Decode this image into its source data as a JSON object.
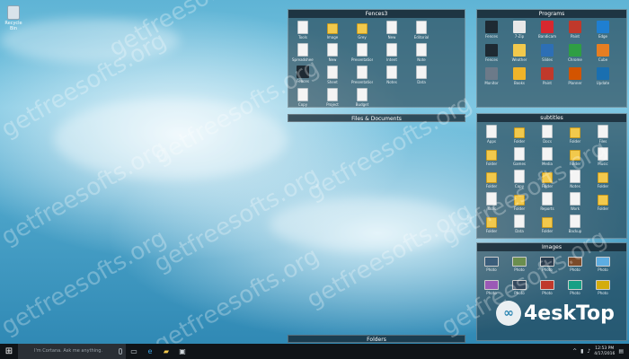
{
  "desktop": {
    "recycle_bin_label": "Recycle Bin"
  },
  "fences": {
    "fences3": {
      "title": "Fences3",
      "items": [
        {
          "label": "Tools",
          "kind": "doc"
        },
        {
          "label": "Image",
          "kind": "folder"
        },
        {
          "label": "Grey",
          "kind": "folder"
        },
        {
          "label": "New",
          "kind": "doc"
        },
        {
          "label": "Editorial",
          "kind": "doc"
        },
        {
          "label": "Spreadsheet",
          "kind": "doc"
        },
        {
          "label": "New",
          "kind": "doc"
        },
        {
          "label": "Presentation",
          "kind": "doc"
        },
        {
          "label": "Intent",
          "kind": "doc"
        },
        {
          "label": "Note",
          "kind": "doc"
        },
        {
          "label": "Fences",
          "kind": "app",
          "color": "#1e2a33"
        },
        {
          "label": "Sheet",
          "kind": "doc"
        },
        {
          "label": "Presentation",
          "kind": "doc"
        },
        {
          "label": "Notes",
          "kind": "doc"
        },
        {
          "label": "Data",
          "kind": "doc"
        },
        {
          "label": "Copy",
          "kind": "doc"
        },
        {
          "label": "Project",
          "kind": "doc"
        },
        {
          "label": "Budget",
          "kind": "doc"
        }
      ]
    },
    "programs": {
      "title": "Programs",
      "items": [
        {
          "label": "Fences",
          "kind": "app",
          "color": "#1e2a33"
        },
        {
          "label": "7-Zip",
          "kind": "app",
          "color": "#e8e8e8"
        },
        {
          "label": "Bandicam",
          "kind": "app",
          "color": "#d7282f"
        },
        {
          "label": "Paint",
          "kind": "app",
          "color": "#c0392b"
        },
        {
          "label": "Edge",
          "kind": "app",
          "color": "#1f7fd1"
        },
        {
          "label": "Fences",
          "kind": "app",
          "color": "#1e2a33"
        },
        {
          "label": "Weather",
          "kind": "app",
          "color": "#f2c94c"
        },
        {
          "label": "Slides",
          "kind": "app",
          "color": "#2d6fb5"
        },
        {
          "label": "Chrome",
          "kind": "app",
          "color": "#2f9e44"
        },
        {
          "label": "Cube",
          "kind": "app",
          "color": "#e67e22"
        },
        {
          "label": "Monitor",
          "kind": "app",
          "color": "#6c7a89"
        },
        {
          "label": "Books",
          "kind": "app",
          "color": "#f0b429"
        },
        {
          "label": "Paint",
          "kind": "app",
          "color": "#c0392b"
        },
        {
          "label": "Planner",
          "kind": "app",
          "color": "#d35400"
        },
        {
          "label": "Update",
          "kind": "app",
          "color": "#1a6fb0"
        }
      ]
    },
    "files_documents": {
      "title": "Files & Documents"
    },
    "subtitles": {
      "title": "subtitles",
      "items": [
        {
          "label": "Apps",
          "kind": "doc"
        },
        {
          "label": "Folder",
          "kind": "folder"
        },
        {
          "label": "Docs",
          "kind": "doc"
        },
        {
          "label": "Folder",
          "kind": "folder"
        },
        {
          "label": "Files",
          "kind": "doc"
        },
        {
          "label": "Folder",
          "kind": "folder"
        },
        {
          "label": "Games",
          "kind": "doc"
        },
        {
          "label": "Media",
          "kind": "doc"
        },
        {
          "label": "Folder",
          "kind": "folder"
        },
        {
          "label": "Music",
          "kind": "doc"
        },
        {
          "label": "Folder",
          "kind": "folder"
        },
        {
          "label": "Copy",
          "kind": "doc"
        },
        {
          "label": "Folder",
          "kind": "folder"
        },
        {
          "label": "Notes",
          "kind": "doc"
        },
        {
          "label": "Folder",
          "kind": "folder"
        },
        {
          "label": "Tools",
          "kind": "doc"
        },
        {
          "label": "Folder",
          "kind": "folder"
        },
        {
          "label": "Reports",
          "kind": "doc"
        },
        {
          "label": "Work",
          "kind": "doc"
        },
        {
          "label": "Folder",
          "kind": "folder"
        },
        {
          "label": "Folder",
          "kind": "folder"
        },
        {
          "label": "Data",
          "kind": "doc"
        },
        {
          "label": "Folder",
          "kind": "folder"
        },
        {
          "label": "Backup",
          "kind": "doc"
        }
      ]
    },
    "images": {
      "title": "Images",
      "items": [
        {
          "label": "Photo",
          "kind": "img",
          "color": "#3a5d7a"
        },
        {
          "label": "Photo",
          "kind": "img",
          "color": "#6b8e4e"
        },
        {
          "label": "Photo",
          "kind": "img",
          "color": "#2c3e50"
        },
        {
          "label": "Photo",
          "kind": "img",
          "color": "#7b4b2a"
        },
        {
          "label": "Photo",
          "kind": "img",
          "color": "#5dade2"
        },
        {
          "label": "Photo",
          "kind": "img",
          "color": "#9b59b6"
        },
        {
          "label": "Photo",
          "kind": "img",
          "color": "#34495e"
        },
        {
          "label": "Photo",
          "kind": "img",
          "color": "#c0392b"
        },
        {
          "label": "Photo",
          "kind": "img",
          "color": "#16a085"
        },
        {
          "label": "Photo",
          "kind": "img",
          "color": "#d4ac0d"
        }
      ]
    },
    "folders": {
      "title": "Folders"
    }
  },
  "watermark": {
    "text": "getfreesofts.org"
  },
  "brand": {
    "text": "4eskTop"
  },
  "taskbar": {
    "search_placeholder": "I'm Cortana. Ask me anything.",
    "time": "12:53 PM",
    "date": "4/17/2016"
  }
}
